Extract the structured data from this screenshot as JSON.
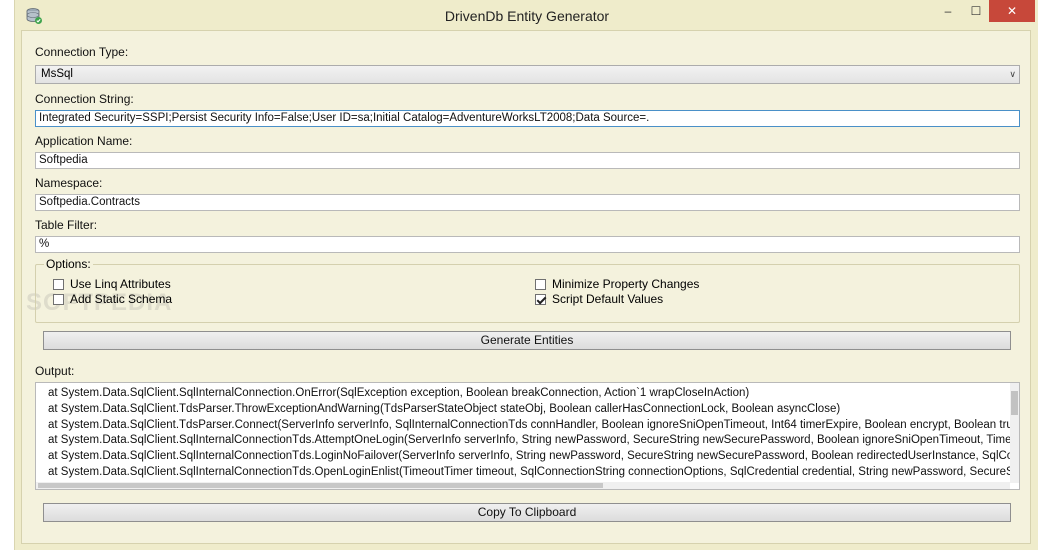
{
  "window": {
    "title": "DrivenDb Entity Generator",
    "controls": {
      "minimize": "–",
      "maximize": "☐",
      "close": "✕"
    }
  },
  "watermark": "SOFTPEDIA",
  "connection_type": {
    "label": "Connection Type:",
    "value": "MsSql"
  },
  "connection_string": {
    "label": "Connection String:",
    "value": "Integrated Security=SSPI;Persist Security Info=False;User ID=sa;Initial Catalog=AdventureWorksLT2008;Data Source=."
  },
  "application_name": {
    "label": "Application Name:",
    "value": "Softpedia"
  },
  "namespace": {
    "label": "Namespace:",
    "value": "Softpedia.Contracts"
  },
  "table_filter": {
    "label": "Table Filter:",
    "value": "%"
  },
  "options": {
    "legend": "Options:",
    "use_linq": {
      "label": "Use Linq Attributes",
      "checked": false
    },
    "add_static_schema": {
      "label": "Add Static Schema",
      "checked": false
    },
    "minimize_property_changes": {
      "label": "Minimize Property Changes",
      "checked": false
    },
    "script_default_values": {
      "label": "Script Default Values",
      "checked": true
    }
  },
  "generate_button": "Generate Entities",
  "output": {
    "label": "Output:",
    "lines": [
      "at System.Data.SqlClient.SqlInternalConnection.OnError(SqlException exception, Boolean breakConnection, Action`1 wrapCloseInAction)",
      "at System.Data.SqlClient.TdsParser.ThrowExceptionAndWarning(TdsParserStateObject stateObj, Boolean callerHasConnectionLock, Boolean asyncClose)",
      "at System.Data.SqlClient.TdsParser.Connect(ServerInfo serverInfo, SqlInternalConnectionTds connHandler, Boolean ignoreSniOpenTimeout, Int64 timerExpire, Boolean encrypt, Boolean trustServerCert, Boolean integratedSecurity, Boolean withFailover)",
      "at System.Data.SqlClient.SqlInternalConnectionTds.AttemptOneLogin(ServerInfo serverInfo, String newPassword, SecureString newSecurePassword, Boolean ignoreSniOpenTimeout, TimeoutTimer timeout, Boolean withFailover)",
      "at System.Data.SqlClient.SqlInternalConnectionTds.LoginNoFailover(ServerInfo serverInfo, String newPassword, SecureString newSecurePassword, Boolean redirectedUserInstance, SqlConnectionString connectionOptions, SqlCredential credential, TimeoutTimer timeout)",
      "at System.Data.SqlClient.SqlInternalConnectionTds.OpenLoginEnlist(TimeoutTimer timeout, SqlConnectionString connectionOptions, SqlCredential credential, String newPassword, SecureString newSecurePassword, Boolean redirectedUserInstance)"
    ]
  },
  "copy_button": "Copy To Clipboard"
}
